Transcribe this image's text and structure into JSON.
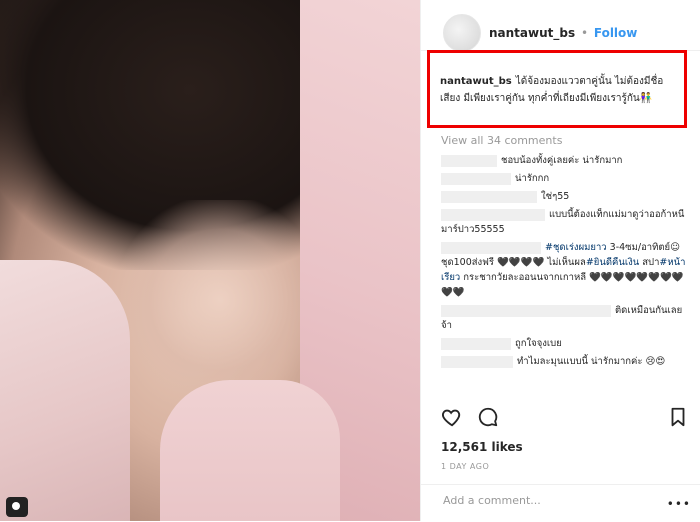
{
  "post": {
    "username": "nantawut_bs",
    "separator": "•",
    "follow_label": "Follow"
  },
  "caption": {
    "username": "nantawut_bs",
    "text": "ได้จ้องมองแววตาคู่นั้น ไม่ต้องมีชื่อเสียง มีเพียงเราคู่กัน ทุกค่ำที่เถียงมีเพียงเรารู้กัน👫"
  },
  "view_all_comments": "View all 34 comments",
  "comments": [
    {
      "text": "ชอบน้องทั้งคู่เลยค่ะ น่ารักมาก"
    },
    {
      "text": "น่ารักกก"
    },
    {
      "text": "ใช่ๆ55"
    },
    {
      "text": "แบบนี้ต้องแท็กแม่มาดูว่าออก้าหนีมาร์ปาว55555"
    },
    {
      "hashtag1": "#ชุดเร่งผมยาว",
      "text_mid": " 3-4ซม/อาทิตย์☺ ชุด100ส่งฟรี 🖤🖤🖤🖤 ไม่เห็นผล",
      "hashtag2": "#ยินดีคืนเงิน",
      "text_mid2": " สปา",
      "hashtag3": "#หน้าเรียว",
      "text_end": " กระชากวัยละออนนจากเกาหลี 🖤🖤🖤🖤🖤🖤🖤🖤🖤🖤"
    },
    {
      "text": "ติดเหมือนกันเลยจ้า"
    },
    {
      "text": "ถูกใจจุงเบย"
    },
    {
      "text": "ทำไมละมุนแบบนี้ น่ารักมากค่ะ 😢😍"
    }
  ],
  "likes": "12,561 likes",
  "timestamp": "1 DAY AGO",
  "add_comment_placeholder": "Add a comment...",
  "more_label": "•••",
  "colors": {
    "follow": "#3897f0",
    "highlight_box": "#e00000",
    "hashtag": "#003569"
  },
  "icons": [
    "heart-icon",
    "comment-icon",
    "bookmark-icon",
    "camera-icon",
    "more-icon"
  ]
}
